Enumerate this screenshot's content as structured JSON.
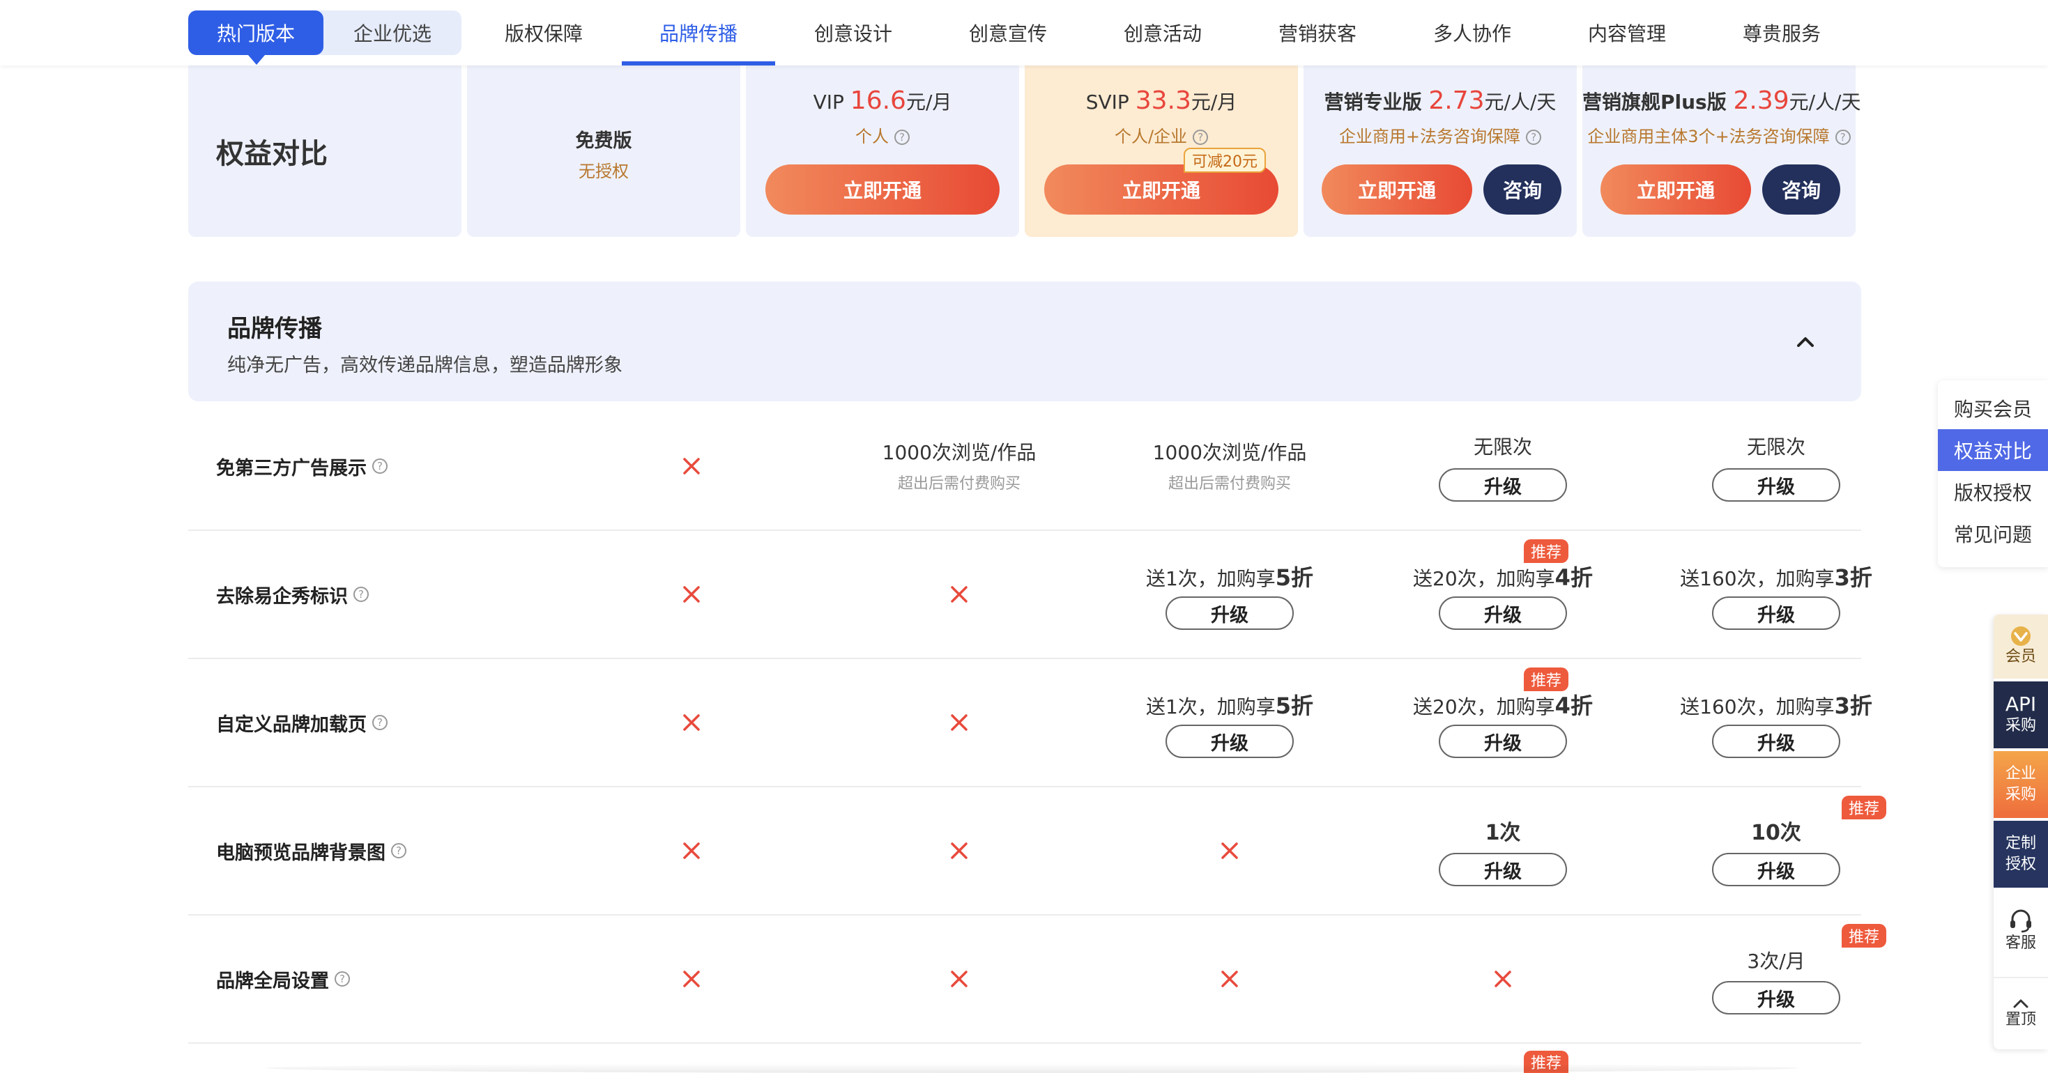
{
  "topnav": {
    "pill_hot": "热门版本",
    "pill_ent": "企业优选",
    "tabs": [
      "版权保障",
      "品牌传播",
      "创意设计",
      "创意宣传",
      "创意活动",
      "营销获客",
      "多人协作",
      "内容管理",
      "尊贵服务"
    ],
    "active_tab": "品牌传播"
  },
  "plans": {
    "title": "权益对比",
    "free": {
      "name": "免费版",
      "sub": "无授权"
    },
    "vip": {
      "name": "VIP ",
      "price": "16.6",
      "unit": "元/月",
      "sub": "个人",
      "button": "立即开通"
    },
    "svip": {
      "name": "SVIP ",
      "price": "33.3",
      "unit": "元/月",
      "sub": "个人/企业",
      "button": "立即开通",
      "discount": "可减20元"
    },
    "pro": {
      "name": "营销专业版 ",
      "price": "2.73",
      "unit": "元/人/天",
      "sub": "企业商用+法务咨询保障",
      "button": "立即开通",
      "consult": "咨询"
    },
    "flagship": {
      "name": "营销旗舰Plus版 ",
      "price": "2.39",
      "unit": "元/人/天",
      "sub": "企业商用主体3个+法务咨询保障",
      "button": "立即开通",
      "consult": "咨询"
    }
  },
  "section": {
    "title": "品牌传播",
    "desc": "纯净无广告，高效传递品牌信息，塑造品牌形象"
  },
  "upgrade_label": "升级",
  "recommend_label": "推荐",
  "rows": [
    {
      "name": "免第三方广告展示",
      "vip_text": "1000次浏览/作品",
      "vip_note": "超出后需付费购买",
      "svip_text": "1000次浏览/作品",
      "svip_note": "超出后需付费购买",
      "pro_text": "无限次",
      "flag_text": "无限次"
    },
    {
      "name": "去除易企秀标识",
      "svip_pre": "送1次，加购享",
      "svip_bold": "5折",
      "pro_pre": "送20次，加购享",
      "pro_bold": "4折",
      "flag_pre": "送160次，加购享",
      "flag_bold": "3折"
    },
    {
      "name": "自定义品牌加载页",
      "svip_pre": "送1次，加购享",
      "svip_bold": "5折",
      "pro_pre": "送20次，加购享",
      "pro_bold": "4折",
      "flag_pre": "送160次，加购享",
      "flag_bold": "3折"
    },
    {
      "name": "电脑预览品牌背景图",
      "pro_text": "1次",
      "flag_text": "10次"
    },
    {
      "name": "品牌全局设置",
      "flag_text": "3次/月"
    }
  ],
  "side_menu": [
    "购买会员",
    "权益对比",
    "版权授权",
    "常见问题"
  ],
  "side_menu_active": "权益对比",
  "toolbar": {
    "vip": "会员",
    "api_1": "API",
    "api_2": "采购",
    "ent_1": "企业",
    "ent_2": "采购",
    "custom_1": "定制",
    "custom_2": "授权",
    "service": "客服",
    "top": "置顶"
  },
  "colors": {
    "primary": "#2f5ee6",
    "price_red": "#e8453c",
    "cross_red": "#e84a3c",
    "gold_text": "#b8782e",
    "svip_bg": "#fdebd2",
    "header_bg": "#eef1fb",
    "consult_navy": "#23305c"
  }
}
